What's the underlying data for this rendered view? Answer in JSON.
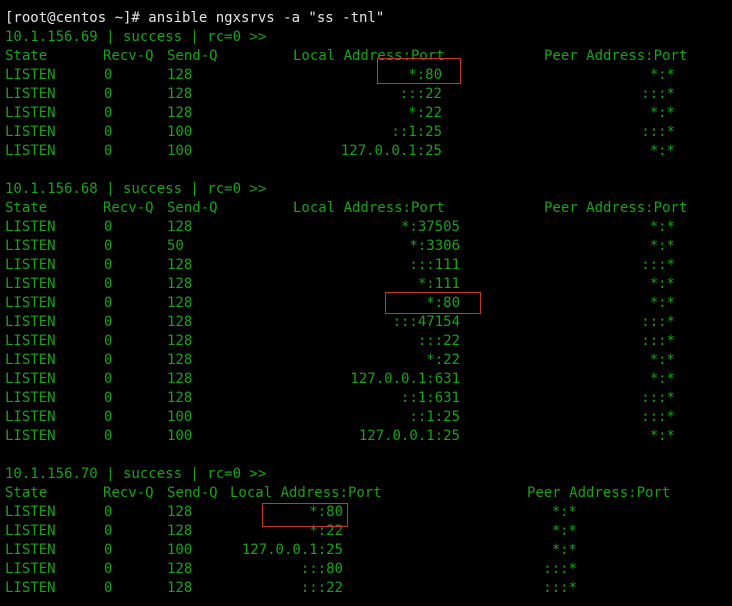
{
  "command_line": "[root@centos ~]# ansible ngxsrvs -a \"ss -tnl\"",
  "header": {
    "state": "State",
    "recvq": "Recv-Q",
    "sendq": "Send-Q",
    "local": "Local Address:Port",
    "peer": "Peer Address:Port"
  },
  "blocks": [
    {
      "summary": "10.1.156.69 | success | rc=0 >>",
      "rows": [
        {
          "state": "LISTEN",
          "recvq": "0",
          "sendq": "128",
          "local": "*:80",
          "peer": "*:*"
        },
        {
          "state": "LISTEN",
          "recvq": "0",
          "sendq": "128",
          "local": ":::22",
          "peer": ":::*"
        },
        {
          "state": "LISTEN",
          "recvq": "0",
          "sendq": "128",
          "local": "*:22",
          "peer": "*:*"
        },
        {
          "state": "LISTEN",
          "recvq": "0",
          "sendq": "100",
          "local": "::1:25",
          "peer": ":::*"
        },
        {
          "state": "LISTEN",
          "recvq": "0",
          "sendq": "100",
          "local": "127.0.0.1:25",
          "peer": "*:*"
        }
      ]
    },
    {
      "summary": "10.1.156.68 | success | rc=0 >>",
      "rows": [
        {
          "state": "LISTEN",
          "recvq": "0",
          "sendq": "128",
          "local": "*:37505",
          "peer": "*:*"
        },
        {
          "state": "LISTEN",
          "recvq": "0",
          "sendq": "50",
          "local": "*:3306",
          "peer": "*:*"
        },
        {
          "state": "LISTEN",
          "recvq": "0",
          "sendq": "128",
          "local": ":::111",
          "peer": ":::*"
        },
        {
          "state": "LISTEN",
          "recvq": "0",
          "sendq": "128",
          "local": "*:111",
          "peer": "*:*"
        },
        {
          "state": "LISTEN",
          "recvq": "0",
          "sendq": "128",
          "local": "*:80",
          "peer": "*:*"
        },
        {
          "state": "LISTEN",
          "recvq": "0",
          "sendq": "128",
          "local": ":::47154",
          "peer": ":::*"
        },
        {
          "state": "LISTEN",
          "recvq": "0",
          "sendq": "128",
          "local": ":::22",
          "peer": ":::*"
        },
        {
          "state": "LISTEN",
          "recvq": "0",
          "sendq": "128",
          "local": "*:22",
          "peer": "*:*"
        },
        {
          "state": "LISTEN",
          "recvq": "0",
          "sendq": "128",
          "local": "127.0.0.1:631",
          "peer": "*:*"
        },
        {
          "state": "LISTEN",
          "recvq": "0",
          "sendq": "128",
          "local": "::1:631",
          "peer": ":::*"
        },
        {
          "state": "LISTEN",
          "recvq": "0",
          "sendq": "100",
          "local": "::1:25",
          "peer": ":::*"
        },
        {
          "state": "LISTEN",
          "recvq": "0",
          "sendq": "100",
          "local": "127.0.0.1:25",
          "peer": "*:*"
        }
      ]
    },
    {
      "summary": "10.1.156.70 | success | rc=0 >>",
      "rows": [
        {
          "state": "LISTEN",
          "recvq": "0",
          "sendq": "128",
          "local": "*:80",
          "peer": "*:*"
        },
        {
          "state": "LISTEN",
          "recvq": "0",
          "sendq": "128",
          "local": "*:22",
          "peer": "*:*"
        },
        {
          "state": "LISTEN",
          "recvq": "0",
          "sendq": "100",
          "local": "127.0.0.1:25",
          "peer": "*:*"
        },
        {
          "state": "LISTEN",
          "recvq": "0",
          "sendq": "128",
          "local": ":::80",
          "peer": ":::*"
        },
        {
          "state": "LISTEN",
          "recvq": "0",
          "sendq": "128",
          "local": ":::22",
          "peer": ":::*"
        }
      ]
    }
  ],
  "colors": {
    "background": "#000000",
    "output_text": "#19a319",
    "command_text": "#e6e6e6",
    "highlight_box": "#c0392b"
  }
}
